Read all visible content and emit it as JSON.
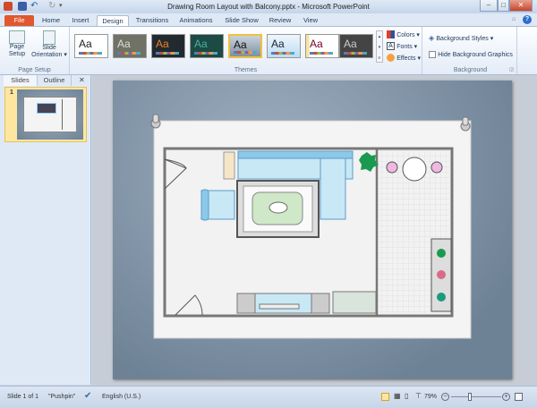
{
  "window": {
    "title": "Drawing Room Layout with Balcony.pptx - Microsoft PowerPoint",
    "minimize": "–",
    "maximize": "□",
    "close": "✕"
  },
  "tabs": [
    "File",
    "Home",
    "Insert",
    "Design",
    "Transitions",
    "Animations",
    "Slide Show",
    "Review",
    "View"
  ],
  "ribbon": {
    "page_setup": {
      "page_setup": "Page Setup",
      "slide_orientation": "Slide Orientation ▾",
      "label": "Page Setup"
    },
    "themes": {
      "label": "Themes",
      "sample": "Aa",
      "count": 8
    },
    "theme_options": {
      "colors": "Colors ▾",
      "fonts": "Fonts ▾",
      "effects": "Effects ▾"
    },
    "background": {
      "styles": "Background Styles ▾",
      "hide": "Hide Background Graphics",
      "label": "Background"
    }
  },
  "pane": {
    "tabs": [
      "Slides",
      "Outline"
    ],
    "close": "✕",
    "slide_number": "1"
  },
  "status": {
    "slide": "Slide 1 of 1",
    "theme": "\"Pushpin\"",
    "language": "English (U.S.)",
    "zoom": "79%",
    "zoom_value": 79
  },
  "colors": {
    "accent": "#e1572e",
    "sofa": "#c8e8f5",
    "wall": "#777777"
  }
}
